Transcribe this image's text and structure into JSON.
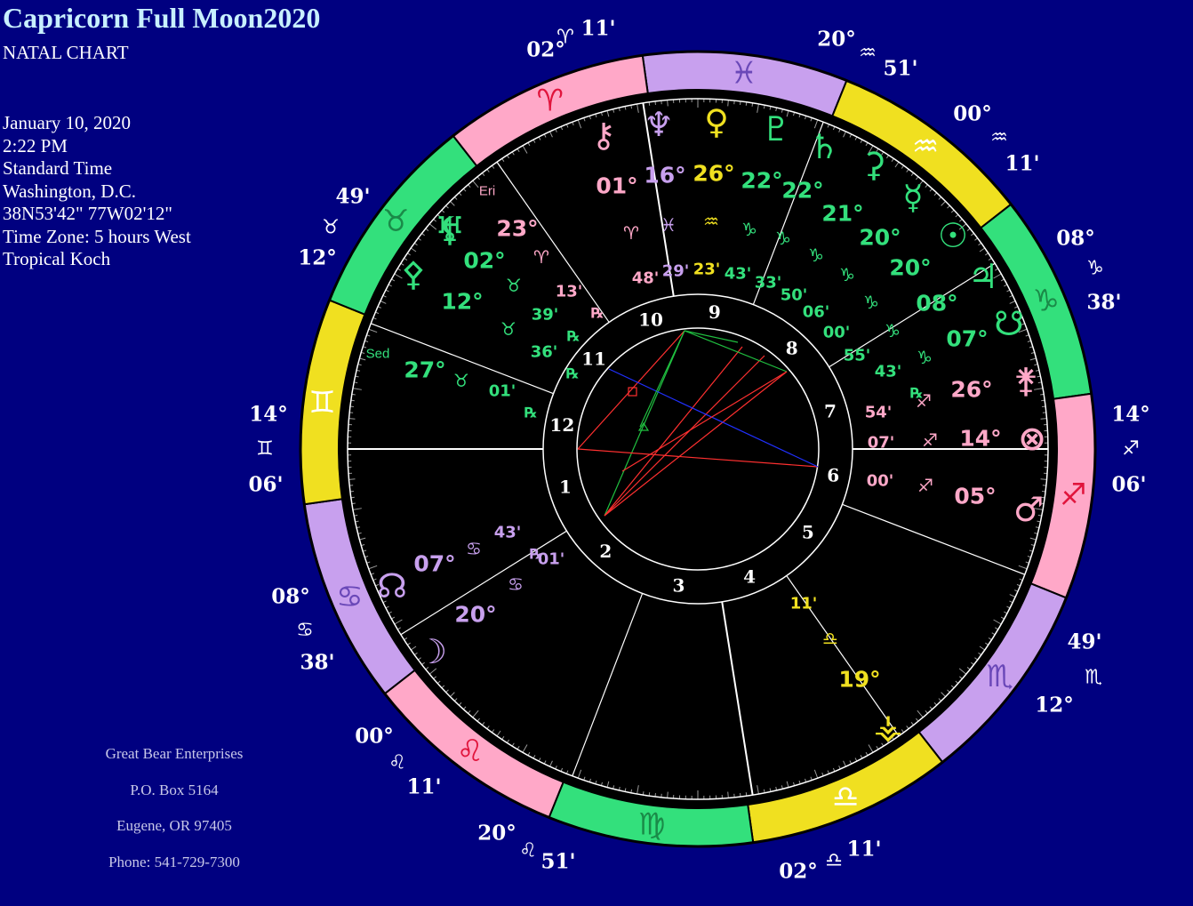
{
  "header": {
    "title": "Capricorn Full Moon2020",
    "subtitle": "NATAL CHART"
  },
  "chart_info": [
    "January 10, 2020",
    "2:22 PM",
    "Standard Time",
    "Washington, D.C.",
    "38N53'42\"  77W02'12\"",
    "Time Zone: 5 hours West",
    "Tropical Koch"
  ],
  "footer": [
    "Great Bear Enterprises",
    "P.O. Box 5164",
    "Eugene, OR 97405",
    "Phone: 541-729-7300"
  ],
  "colors": {
    "background": "#000080",
    "fire": "#ffa8c8",
    "earth": "#33e07c",
    "air": "#f0e020",
    "water": "#c8a0ee",
    "aspect_red": "#ff3030",
    "aspect_green": "#20c040",
    "aspect_blue": "#2030ff"
  },
  "zodiac_ring": [
    {
      "sign": "Pisces",
      "glyph": "♓"
    },
    {
      "sign": "Aquarius",
      "glyph": "♒"
    },
    {
      "sign": "Capricorn",
      "glyph": "♑"
    },
    {
      "sign": "Sagittarius",
      "glyph": "♐"
    },
    {
      "sign": "Scorpio",
      "glyph": "♏"
    },
    {
      "sign": "Libra",
      "glyph": "♎"
    },
    {
      "sign": "Virgo",
      "glyph": "♍"
    },
    {
      "sign": "Leo",
      "glyph": "♌"
    },
    {
      "sign": "Cancer",
      "glyph": "♋"
    },
    {
      "sign": "Gemini",
      "glyph": "♊"
    },
    {
      "sign": "Taurus",
      "glyph": "♉"
    },
    {
      "sign": "Aries",
      "glyph": "♈"
    }
  ],
  "house_cusps": [
    {
      "label": "02°",
      "sign": "♈",
      "minutes": "11'"
    },
    {
      "label": "20°",
      "sign": "♒",
      "minutes": "51'"
    },
    {
      "label": "00°",
      "sign": "♒",
      "minutes": "11'"
    },
    {
      "label": "08°",
      "sign": "♑",
      "minutes": "38'"
    },
    {
      "label": "14°",
      "sign": "♐",
      "minutes": "06'"
    },
    {
      "label": "49'",
      "sign": "♏",
      "minutes": "12°"
    },
    {
      "label": "02°",
      "sign": "♎",
      "minutes": "11'"
    },
    {
      "label": "20°",
      "sign": "♌",
      "minutes": "51'"
    },
    {
      "label": "00°",
      "sign": "♌",
      "minutes": "11'"
    },
    {
      "label": "08°",
      "sign": "♋",
      "minutes": "38'"
    },
    {
      "label": "14°",
      "sign": "♊",
      "minutes": "06'"
    },
    {
      "label": "49'",
      "sign": "♉",
      "minutes": "12°"
    }
  ],
  "house_numbers": [
    "1",
    "2",
    "3",
    "4",
    "5",
    "6",
    "7",
    "8",
    "9",
    "10",
    "11",
    "12"
  ],
  "planets": [
    {
      "name": "Chiron",
      "glyph": "⚷",
      "deg": "01°",
      "sign": "♈",
      "min": "48'",
      "retro": ""
    },
    {
      "name": "Neptune",
      "glyph": "♆",
      "deg": "16°",
      "sign": "♓",
      "min": "29'",
      "retro": ""
    },
    {
      "name": "Venus",
      "glyph": "♀",
      "deg": "26°",
      "sign": "♒",
      "min": "23'",
      "retro": ""
    },
    {
      "name": "Pluto",
      "glyph": "♇",
      "deg": "22°",
      "sign": "♑",
      "min": "43'",
      "retro": ""
    },
    {
      "name": "Saturn",
      "glyph": "♄",
      "deg": "22°",
      "sign": "♑",
      "min": "33'",
      "retro": ""
    },
    {
      "name": "Ceres",
      "glyph": "⚳",
      "deg": "21°",
      "sign": "♑",
      "min": "50'",
      "retro": ""
    },
    {
      "name": "Mercury",
      "glyph": "☿",
      "deg": "20°",
      "sign": "♑",
      "min": "06'",
      "retro": ""
    },
    {
      "name": "Sun",
      "glyph": "☉",
      "deg": "20°",
      "sign": "♑",
      "min": "00'",
      "retro": ""
    },
    {
      "name": "Jupiter",
      "glyph": "♃",
      "deg": "08°",
      "sign": "♑",
      "min": "55'",
      "retro": ""
    },
    {
      "name": "South Node",
      "glyph": "☋",
      "deg": "07°",
      "sign": "♑",
      "min": "43'",
      "retro": "℞"
    },
    {
      "name": "Juno",
      "glyph": "⚵",
      "deg": "26°",
      "sign": "♐",
      "min": "54'",
      "retro": ""
    },
    {
      "name": "Part of Fortune",
      "glyph": "⊗",
      "deg": "14°",
      "sign": "♐",
      "min": "07'",
      "retro": ""
    },
    {
      "name": "Mars",
      "glyph": "♂",
      "deg": "05°",
      "sign": "♐",
      "min": "00'",
      "retro": ""
    },
    {
      "name": "Vesta",
      "glyph": "⚶",
      "deg": "19°",
      "sign": "♎",
      "min": "11'",
      "retro": ""
    },
    {
      "name": "Moon",
      "glyph": "☽",
      "deg": "20°",
      "sign": "♋",
      "min": "01'",
      "retro": ""
    },
    {
      "name": "North Node",
      "glyph": "☊",
      "deg": "07°",
      "sign": "♋",
      "min": "43'",
      "retro": "℞"
    },
    {
      "name": "Pallas",
      "glyph": "⚴",
      "deg": "27°",
      "sign": "♉",
      "min": "01'",
      "retro": "℞"
    },
    {
      "name": "Lilith",
      "glyph": "⚸",
      "deg": "12°",
      "sign": "♉",
      "min": "36'",
      "retro": "℞"
    },
    {
      "name": "Uranus",
      "glyph": "♅",
      "deg": "02°",
      "sign": "♉",
      "min": "39'",
      "retro": "℞"
    },
    {
      "name": "Eris",
      "glyph": "",
      "deg": "23°",
      "sign": "♈",
      "min": "13'",
      "retro": "℞"
    }
  ],
  "minor_labels": [
    "Eri",
    "Sed"
  ]
}
